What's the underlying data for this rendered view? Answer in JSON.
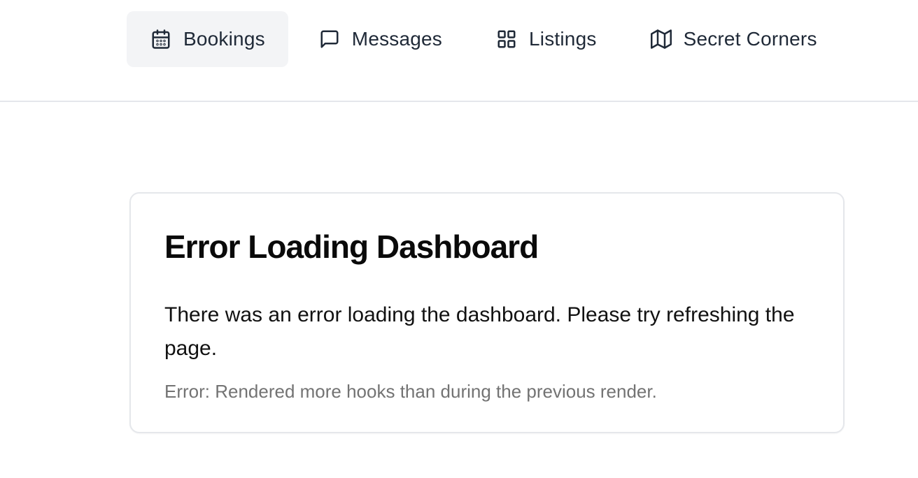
{
  "nav": {
    "items": [
      {
        "label": "Bookings",
        "icon": "calendar-icon",
        "active": true
      },
      {
        "label": "Messages",
        "icon": "message-square-icon",
        "active": false
      },
      {
        "label": "Listings",
        "icon": "grid-icon",
        "active": false
      },
      {
        "label": "Secret Corners",
        "icon": "map-icon",
        "active": false
      }
    ]
  },
  "error_card": {
    "title": "Error Loading Dashboard",
    "message": "There was an error loading the dashboard. Please try refreshing the page.",
    "detail": "Error: Rendered more hooks than during the previous render."
  },
  "colors": {
    "active_nav_bg": "#f3f4f6",
    "border": "#e5e7eb",
    "muted_text": "#737373"
  }
}
